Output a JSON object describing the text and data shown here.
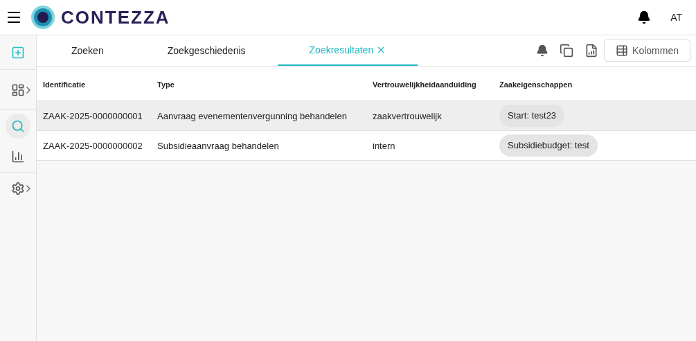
{
  "header": {
    "logo_text": "CONTEZZA",
    "user_initials": "AT"
  },
  "sidebar": {
    "items": [
      {
        "kind": "add",
        "selected": false,
        "expandable": false
      },
      {
        "kind": "dashboard",
        "selected": false,
        "expandable": true
      },
      {
        "kind": "search",
        "selected": true,
        "expandable": false
      },
      {
        "kind": "chart",
        "selected": false,
        "expandable": false
      },
      {
        "kind": "settings",
        "selected": false,
        "expandable": true
      }
    ]
  },
  "tabs": [
    {
      "label": "Zoeken",
      "selected": false,
      "closable": false
    },
    {
      "label": "Zoekgeschiedenis",
      "selected": false,
      "closable": false
    },
    {
      "label": "Zoekresultaten",
      "selected": true,
      "closable": true
    }
  ],
  "toolbar": {
    "columns_button": "Kolommen"
  },
  "table": {
    "columns": [
      "Identificatie",
      "Type",
      "Vertrouwelijkheidaanduiding",
      "Zaakeigenschappen"
    ],
    "rows": [
      {
        "highlighted": true,
        "cells": [
          "ZAAK-2025-0000000001",
          "Aanvraag evenementenvergunning behandelen",
          "zaakvertrouwelijk"
        ],
        "tags": [
          "Start: test23"
        ]
      },
      {
        "highlighted": false,
        "cells": [
          "ZAAK-2025-0000000002",
          "Subsidieaanvraag behandelen",
          "intern"
        ],
        "tags": [
          "Subsidiebudget: test"
        ]
      }
    ]
  }
}
